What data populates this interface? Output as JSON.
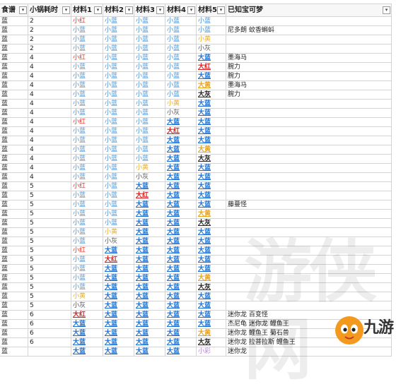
{
  "headers": [
    "食谱",
    "小锅耗时",
    "材料1",
    "材料2",
    "材料3",
    "材料4",
    "材料5",
    "已知宝可梦"
  ],
  "filter_icon": "dropdown-arrow-icon",
  "legend_colors": {
    "red": "#e8322b",
    "blue": "#4b8fd3",
    "yellow": "#e8ad2c",
    "gray": "#555555",
    "purple": "#b486d9"
  },
  "rows": [
    {
      "recipe": "蓝",
      "time": "2",
      "m": [
        [
          "小红",
          "r"
        ],
        [
          "小蓝",
          "b"
        ],
        [
          "小蓝",
          "b"
        ],
        [
          "小蓝",
          "b"
        ],
        [
          "小蓝",
          "b"
        ]
      ],
      "pokemon": ""
    },
    {
      "recipe": "蓝",
      "time": "2",
      "m": [
        [
          "小蓝",
          "b"
        ],
        [
          "小蓝",
          "b"
        ],
        [
          "小蓝",
          "b"
        ],
        [
          "小蓝",
          "b"
        ],
        [
          "小蓝",
          "b"
        ]
      ],
      "pokemon": "尼多朗 蚊香蝌蚪"
    },
    {
      "recipe": "蓝",
      "time": "2",
      "m": [
        [
          "小蓝",
          "b"
        ],
        [
          "小蓝",
          "b"
        ],
        [
          "小蓝",
          "b"
        ],
        [
          "小蓝",
          "b"
        ],
        [
          "小黄",
          "y"
        ]
      ],
      "pokemon": ""
    },
    {
      "recipe": "蓝",
      "time": "2",
      "m": [
        [
          "小蓝",
          "b"
        ],
        [
          "小蓝",
          "b"
        ],
        [
          "小蓝",
          "b"
        ],
        [
          "小蓝",
          "b"
        ],
        [
          "小灰",
          "g"
        ]
      ],
      "pokemon": ""
    },
    {
      "recipe": "蓝",
      "time": "4",
      "m": [
        [
          "小红",
          "r"
        ],
        [
          "小蓝",
          "b"
        ],
        [
          "小蓝",
          "b"
        ],
        [
          "小蓝",
          "b"
        ],
        [
          "大蓝",
          "B"
        ]
      ],
      "pokemon": "墨海马"
    },
    {
      "recipe": "蓝",
      "time": "4",
      "m": [
        [
          "小蓝",
          "b"
        ],
        [
          "小蓝",
          "b"
        ],
        [
          "小蓝",
          "b"
        ],
        [
          "小蓝",
          "b"
        ],
        [
          "大红",
          "R"
        ]
      ],
      "pokemon": "腕力"
    },
    {
      "recipe": "蓝",
      "time": "4",
      "m": [
        [
          "小蓝",
          "b"
        ],
        [
          "小蓝",
          "b"
        ],
        [
          "小蓝",
          "b"
        ],
        [
          "小蓝",
          "b"
        ],
        [
          "大蓝",
          "B"
        ]
      ],
      "pokemon": "腕力"
    },
    {
      "recipe": "蓝",
      "time": "4",
      "m": [
        [
          "小蓝",
          "b"
        ],
        [
          "小蓝",
          "b"
        ],
        [
          "小蓝",
          "b"
        ],
        [
          "小蓝",
          "b"
        ],
        [
          "大黄",
          "Y"
        ]
      ],
      "pokemon": "墨海马"
    },
    {
      "recipe": "蓝",
      "time": "4",
      "m": [
        [
          "小蓝",
          "b"
        ],
        [
          "小蓝",
          "b"
        ],
        [
          "小蓝",
          "b"
        ],
        [
          "小蓝",
          "b"
        ],
        [
          "大灰",
          "G"
        ]
      ],
      "pokemon": "腕力"
    },
    {
      "recipe": "蓝",
      "time": "4",
      "m": [
        [
          "小蓝",
          "b"
        ],
        [
          "小蓝",
          "b"
        ],
        [
          "小蓝",
          "b"
        ],
        [
          "小黄",
          "y"
        ],
        [
          "大蓝",
          "B"
        ]
      ],
      "pokemon": ""
    },
    {
      "recipe": "蓝",
      "time": "4",
      "m": [
        [
          "小蓝",
          "b"
        ],
        [
          "小蓝",
          "b"
        ],
        [
          "小蓝",
          "b"
        ],
        [
          "小灰",
          "g"
        ],
        [
          "大蓝",
          "B"
        ]
      ],
      "pokemon": ""
    },
    {
      "recipe": "蓝",
      "time": "4",
      "m": [
        [
          "小红",
          "r"
        ],
        [
          "小蓝",
          "b"
        ],
        [
          "小蓝",
          "b"
        ],
        [
          "大蓝",
          "B"
        ],
        [
          "大蓝",
          "B"
        ]
      ],
      "pokemon": ""
    },
    {
      "recipe": "蓝",
      "time": "4",
      "m": [
        [
          "小蓝",
          "b"
        ],
        [
          "小蓝",
          "b"
        ],
        [
          "小蓝",
          "b"
        ],
        [
          "大红",
          "R"
        ],
        [
          "大蓝",
          "B"
        ]
      ],
      "pokemon": ""
    },
    {
      "recipe": "蓝",
      "time": "4",
      "m": [
        [
          "小蓝",
          "b"
        ],
        [
          "小蓝",
          "b"
        ],
        [
          "小蓝",
          "b"
        ],
        [
          "大蓝",
          "B"
        ],
        [
          "大蓝",
          "B"
        ]
      ],
      "pokemon": ""
    },
    {
      "recipe": "蓝",
      "time": "4",
      "m": [
        [
          "小蓝",
          "b"
        ],
        [
          "小蓝",
          "b"
        ],
        [
          "小蓝",
          "b"
        ],
        [
          "大蓝",
          "B"
        ],
        [
          "大黄",
          "Y"
        ]
      ],
      "pokemon": ""
    },
    {
      "recipe": "蓝",
      "time": "4",
      "m": [
        [
          "小蓝",
          "b"
        ],
        [
          "小蓝",
          "b"
        ],
        [
          "小蓝",
          "b"
        ],
        [
          "大蓝",
          "B"
        ],
        [
          "大灰",
          "G"
        ]
      ],
      "pokemon": ""
    },
    {
      "recipe": "蓝",
      "time": "4",
      "m": [
        [
          "小蓝",
          "b"
        ],
        [
          "小蓝",
          "b"
        ],
        [
          "小黄",
          "y"
        ],
        [
          "大蓝",
          "B"
        ],
        [
          "大蓝",
          "B"
        ]
      ],
      "pokemon": ""
    },
    {
      "recipe": "蓝",
      "time": "4",
      "m": [
        [
          "小蓝",
          "b"
        ],
        [
          "小蓝",
          "b"
        ],
        [
          "小灰",
          "g"
        ],
        [
          "大蓝",
          "B"
        ],
        [
          "大蓝",
          "B"
        ]
      ],
      "pokemon": ""
    },
    {
      "recipe": "蓝",
      "time": "5",
      "m": [
        [
          "小红",
          "r"
        ],
        [
          "小蓝",
          "b"
        ],
        [
          "大蓝",
          "B"
        ],
        [
          "大蓝",
          "B"
        ],
        [
          "大蓝",
          "B"
        ]
      ],
      "pokemon": ""
    },
    {
      "recipe": "蓝",
      "time": "5",
      "m": [
        [
          "小蓝",
          "b"
        ],
        [
          "小蓝",
          "b"
        ],
        [
          "大红",
          "R"
        ],
        [
          "大蓝",
          "B"
        ],
        [
          "大蓝",
          "B"
        ]
      ],
      "pokemon": ""
    },
    {
      "recipe": "蓝",
      "time": "5",
      "m": [
        [
          "小蓝",
          "b"
        ],
        [
          "小蓝",
          "b"
        ],
        [
          "大蓝",
          "B"
        ],
        [
          "大蓝",
          "B"
        ],
        [
          "大蓝",
          "B"
        ]
      ],
      "pokemon": "藤蔓怪"
    },
    {
      "recipe": "蓝",
      "time": "5",
      "m": [
        [
          "小蓝",
          "b"
        ],
        [
          "小蓝",
          "b"
        ],
        [
          "大蓝",
          "B"
        ],
        [
          "大蓝",
          "B"
        ],
        [
          "大黄",
          "Y"
        ]
      ],
      "pokemon": ""
    },
    {
      "recipe": "蓝",
      "time": "5",
      "m": [
        [
          "小蓝",
          "b"
        ],
        [
          "小蓝",
          "b"
        ],
        [
          "大蓝",
          "B"
        ],
        [
          "大蓝",
          "B"
        ],
        [
          "大灰",
          "G"
        ]
      ],
      "pokemon": ""
    },
    {
      "recipe": "蓝",
      "time": "5",
      "m": [
        [
          "小蓝",
          "b"
        ],
        [
          "小黄",
          "y"
        ],
        [
          "大蓝",
          "B"
        ],
        [
          "大蓝",
          "B"
        ],
        [
          "大蓝",
          "B"
        ]
      ],
      "pokemon": ""
    },
    {
      "recipe": "蓝",
      "time": "5",
      "m": [
        [
          "小蓝",
          "b"
        ],
        [
          "小灰",
          "g"
        ],
        [
          "大蓝",
          "B"
        ],
        [
          "大蓝",
          "B"
        ],
        [
          "大蓝",
          "B"
        ]
      ],
      "pokemon": ""
    },
    {
      "recipe": "蓝",
      "time": "5",
      "m": [
        [
          "小红",
          "r"
        ],
        [
          "大蓝",
          "B"
        ],
        [
          "大蓝",
          "B"
        ],
        [
          "大蓝",
          "B"
        ],
        [
          "大蓝",
          "B"
        ]
      ],
      "pokemon": ""
    },
    {
      "recipe": "蓝",
      "time": "5",
      "m": [
        [
          "小蓝",
          "b"
        ],
        [
          "大红",
          "R"
        ],
        [
          "大蓝",
          "B"
        ],
        [
          "大蓝",
          "B"
        ],
        [
          "大蓝",
          "B"
        ]
      ],
      "pokemon": ""
    },
    {
      "recipe": "蓝",
      "time": "5",
      "m": [
        [
          "小蓝",
          "b"
        ],
        [
          "大蓝",
          "B"
        ],
        [
          "大蓝",
          "B"
        ],
        [
          "大蓝",
          "B"
        ],
        [
          "大蓝",
          "B"
        ]
      ],
      "pokemon": ""
    },
    {
      "recipe": "蓝",
      "time": "5",
      "m": [
        [
          "小蓝",
          "b"
        ],
        [
          "大蓝",
          "B"
        ],
        [
          "大蓝",
          "B"
        ],
        [
          "大蓝",
          "B"
        ],
        [
          "大黄",
          "Y"
        ]
      ],
      "pokemon": ""
    },
    {
      "recipe": "蓝",
      "time": "5",
      "m": [
        [
          "小蓝",
          "b"
        ],
        [
          "大蓝",
          "B"
        ],
        [
          "大蓝",
          "B"
        ],
        [
          "大蓝",
          "B"
        ],
        [
          "大灰",
          "G"
        ]
      ],
      "pokemon": ""
    },
    {
      "recipe": "蓝",
      "time": "5",
      "m": [
        [
          "小黄",
          "y"
        ],
        [
          "大蓝",
          "B"
        ],
        [
          "大蓝",
          "B"
        ],
        [
          "大蓝",
          "B"
        ],
        [
          "大蓝",
          "B"
        ]
      ],
      "pokemon": ""
    },
    {
      "recipe": "蓝",
      "time": "5",
      "m": [
        [
          "小灰",
          "g"
        ],
        [
          "大蓝",
          "B"
        ],
        [
          "大蓝",
          "B"
        ],
        [
          "大蓝",
          "B"
        ],
        [
          "大蓝",
          "B"
        ]
      ],
      "pokemon": ""
    },
    {
      "recipe": "蓝",
      "time": "6",
      "m": [
        [
          "大红",
          "R"
        ],
        [
          "大蓝",
          "B"
        ],
        [
          "大蓝",
          "B"
        ],
        [
          "大蓝",
          "B"
        ],
        [
          "大蓝",
          "B"
        ]
      ],
      "pokemon": "迷你龙 百变怪"
    },
    {
      "recipe": "蓝",
      "time": "6",
      "m": [
        [
          "大蓝",
          "B"
        ],
        [
          "大蓝",
          "B"
        ],
        [
          "大蓝",
          "B"
        ],
        [
          "大蓝",
          "B"
        ],
        [
          "大蓝",
          "B"
        ]
      ],
      "pokemon": "杰尼龟 迷你龙 鲤鱼王"
    },
    {
      "recipe": "蓝",
      "time": "6",
      "m": [
        [
          "大蓝",
          "B"
        ],
        [
          "大蓝",
          "B"
        ],
        [
          "大蓝",
          "B"
        ],
        [
          "大蓝",
          "B"
        ],
        [
          "大黄",
          "Y"
        ]
      ],
      "pokemon": "迷你龙 鲤鱼王 菊石兽"
    },
    {
      "recipe": "蓝",
      "time": "6",
      "m": [
        [
          "大蓝",
          "B"
        ],
        [
          "大蓝",
          "B"
        ],
        [
          "大蓝",
          "B"
        ],
        [
          "大蓝",
          "B"
        ],
        [
          "大灰",
          "G"
        ]
      ],
      "pokemon": "迷你龙 拉普拉斯 鲤鱼王"
    },
    {
      "recipe": "蓝",
      "time": "",
      "m": [
        [
          "大蓝",
          "B"
        ],
        [
          "大蓝",
          "B"
        ],
        [
          "大蓝",
          "B"
        ],
        [
          "大蓝",
          "B"
        ],
        [
          "小彩",
          "p"
        ]
      ],
      "pokemon": "迷你龙"
    }
  ],
  "watermark_text": "游侠网",
  "logo_text": "九游"
}
